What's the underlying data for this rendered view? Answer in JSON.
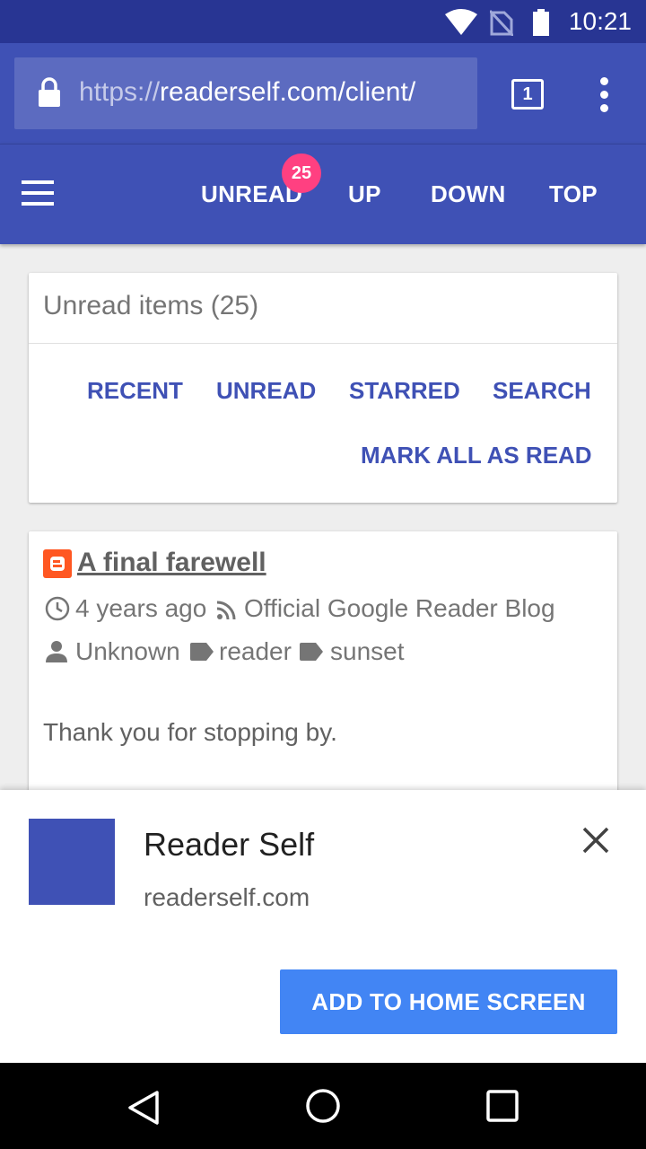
{
  "status_bar": {
    "time": "10:21"
  },
  "browser": {
    "url_scheme": "https://",
    "url_rest": "readerself.com/client/",
    "tab_count": "1"
  },
  "toolbar": {
    "unread_label": "UNREAD",
    "unread_badge": "25",
    "up_label": "UP",
    "down_label": "DOWN",
    "top_label": "TOP"
  },
  "summary_card": {
    "title": "Unread items (25)",
    "actions": [
      "RECENT",
      "UNREAD",
      "STARRED",
      "SEARCH"
    ],
    "mark_all": "MARK ALL AS READ"
  },
  "article": {
    "title": "A final farewell",
    "time": "4 years ago",
    "feed": "Official Google Reader Blog",
    "author": "Unknown",
    "tags": [
      "reader",
      "sunset"
    ],
    "body": "Thank you for stopping by."
  },
  "install_banner": {
    "app_name": "Reader Self",
    "app_url": "readerself.com",
    "button_label": "ADD TO HOME SCREEN",
    "icon_color": "#3f51b5"
  },
  "colors": {
    "primary": "#3f51b5",
    "primary_dark": "#283593",
    "accent": "#ff4081",
    "install_button": "#4285f4"
  }
}
